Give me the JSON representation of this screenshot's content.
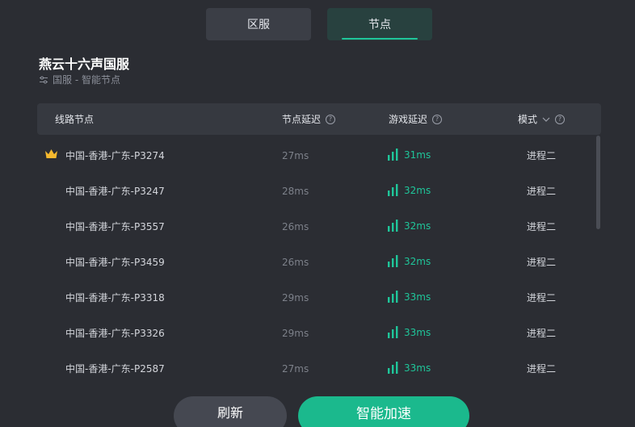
{
  "tabs": [
    {
      "label": "区服",
      "active": false
    },
    {
      "label": "节点",
      "active": true
    }
  ],
  "game": {
    "title": "燕云十六声国服",
    "subtitle": "国服 - 智能节点",
    "subtitle_icon": "sliders-icon"
  },
  "table": {
    "headers": {
      "node": "线路节点",
      "node_latency": "节点延迟",
      "game_latency": "游戏延迟",
      "mode": "模式"
    },
    "help_glyph": "?",
    "rows": [
      {
        "name": "中国-香港-广东-P3274",
        "ping": "27ms",
        "game_ping": "31ms",
        "mode": "进程二",
        "crown": true
      },
      {
        "name": "中国-香港-广东-P3247",
        "ping": "28ms",
        "game_ping": "32ms",
        "mode": "进程二",
        "crown": false
      },
      {
        "name": "中国-香港-广东-P3557",
        "ping": "26ms",
        "game_ping": "32ms",
        "mode": "进程二",
        "crown": false
      },
      {
        "name": "中国-香港-广东-P3459",
        "ping": "26ms",
        "game_ping": "32ms",
        "mode": "进程二",
        "crown": false
      },
      {
        "name": "中国-香港-广东-P3318",
        "ping": "29ms",
        "game_ping": "33ms",
        "mode": "进程二",
        "crown": false
      },
      {
        "name": "中国-香港-广东-P3326",
        "ping": "29ms",
        "game_ping": "33ms",
        "mode": "进程二",
        "crown": false
      },
      {
        "name": "中国-香港-广东-P2587",
        "ping": "27ms",
        "game_ping": "33ms",
        "mode": "进程二",
        "crown": false
      }
    ]
  },
  "buttons": {
    "refresh": "刷新",
    "accelerate": "智能加速"
  },
  "colors": {
    "background": "#2b2d33",
    "accent": "#1fc69a",
    "crown": "#f5b82e"
  }
}
